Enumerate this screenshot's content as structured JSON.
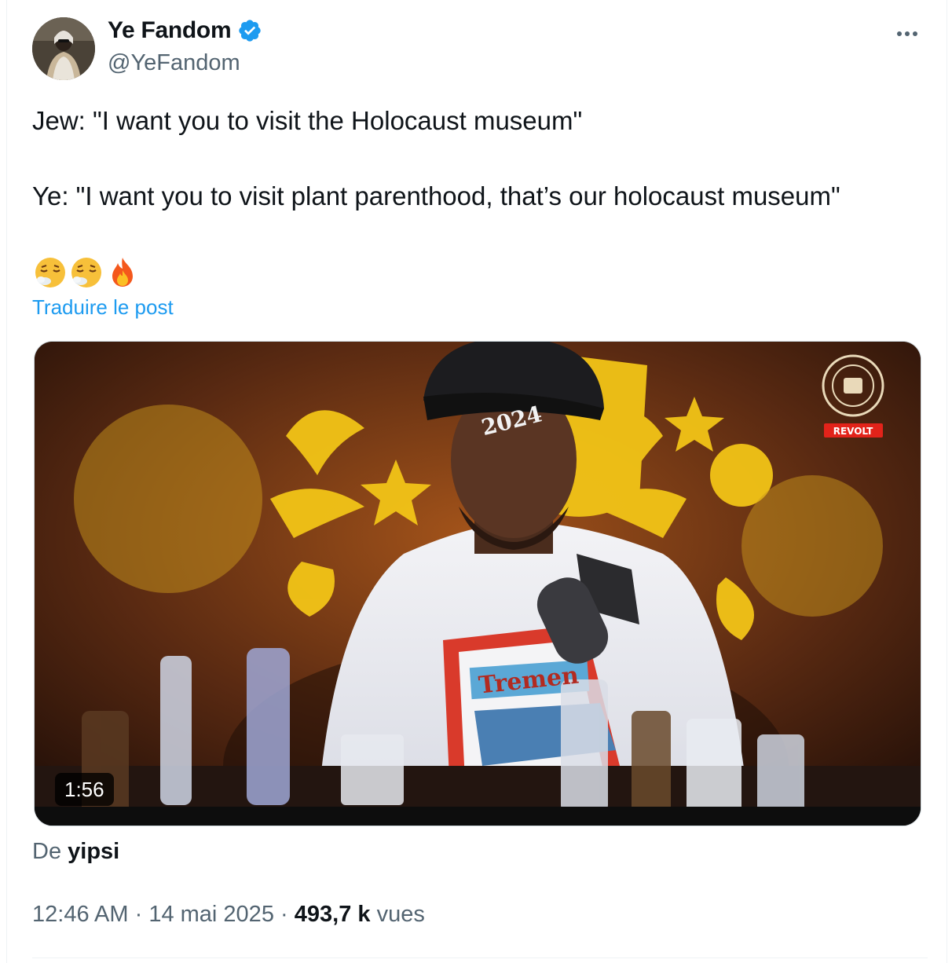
{
  "author": {
    "display_name": "Ye Fandom",
    "handle": "@YeFandom",
    "verified": true
  },
  "tweet": {
    "line1": "Jew: \"I want you to visit the Holocaust museum\"",
    "line2": "Ye: \"I want you to visit plant parenthood, that’s our holocaust museum\"",
    "emojis": [
      "face-exhaling-icon",
      "face-exhaling-icon",
      "fire-icon"
    ],
    "translate_label": "Traduire le post"
  },
  "media": {
    "duration": "1:56",
    "cap_text": "2024",
    "shirt_text": "Tremen",
    "watermark": "REVOLT"
  },
  "attribution": {
    "prefix": "De",
    "source": "yipsi"
  },
  "meta": {
    "time": "12:46 AM",
    "separator": "·",
    "date": "14 mai 2025",
    "views_count": "493,7 k",
    "views_label": "vues"
  },
  "colors": {
    "accent": "#1d9bf0",
    "secondary_text": "#536471",
    "primary_text": "#0f1419"
  }
}
